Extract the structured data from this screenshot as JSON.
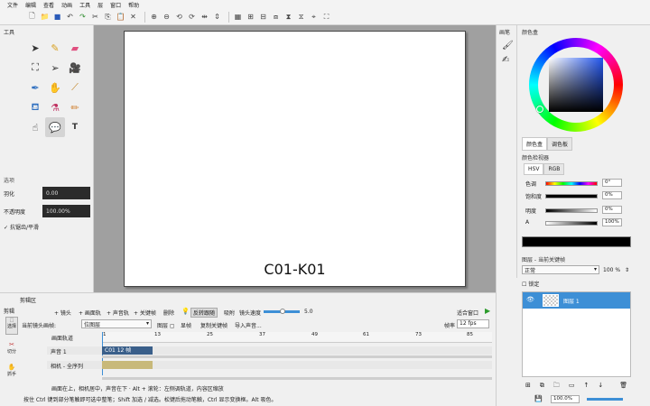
{
  "menu": [
    "文件",
    "编辑",
    "查看",
    "动画",
    "工具",
    "层",
    "窗口",
    "帮助"
  ],
  "panels": {
    "tools": "工具",
    "options": "选项",
    "brushes": "画笔",
    "color_box": "颜色盒",
    "color_box_tab": "颜色盒",
    "color_palette_tab": "调色板",
    "color_inspector": "颜色检视器",
    "layers": "图层 - 当前关键帧",
    "timeline": "剪辑区"
  },
  "options": {
    "feather_label": "羽化",
    "feather_value": "0.00",
    "opacity_label": "不透明度",
    "opacity_value": "100.00%",
    "antialias_label": "抗锯齿/平滑"
  },
  "canvas": {
    "caption": "C01-K01"
  },
  "color_inspector": {
    "tabs": [
      "HSV",
      "RGB"
    ],
    "rows": [
      {
        "label": "色调",
        "value": "0°"
      },
      {
        "label": "饱和度",
        "value": "0%"
      },
      {
        "label": "明度",
        "value": "0%"
      },
      {
        "label": "A",
        "value": "100%"
      }
    ]
  },
  "layers": {
    "blend_mode": "正常",
    "opacity": "100 %",
    "lock_label": "锁定",
    "layer_name": "图层 1",
    "zoom": "100.0%"
  },
  "timeline": {
    "top_label": "剪辑",
    "buttons": [
      "+ 镜头",
      "+ 画面轨",
      "+ 声音轨",
      "+ 关键帧",
      "删除"
    ],
    "onion": "反转跟随",
    "loop": "吸附",
    "speed_label": "镜头速度",
    "speed_value": "5.0",
    "fit_label": "适合窗口",
    "current_label": "当前镜头画帧:",
    "current_layer": "位图层",
    "layer_opts": [
      "图层 ▢",
      "显帧",
      "复制关键帧",
      "导入声音..."
    ],
    "fps_label": "帧率",
    "fps_value": "12 fps",
    "header": "画面轨道",
    "ticks": [
      "1",
      "13",
      "25",
      "37",
      "49",
      "61",
      "73",
      "85"
    ],
    "tracks": [
      {
        "name": "声音 1",
        "clip": "C01   12 帧"
      },
      {
        "name": "相机 - 全序列",
        "clip": ""
      }
    ],
    "side_tools": [
      "选择",
      "切分",
      "抓手"
    ],
    "hint": "画面在上，相机居中，声音在下 · Alt + 滚轮：左侧调轨道，内容区缩放",
    "status": "按住 Ctrl 键到部分笔触即可选中整笔；Shift 加选 / 减选。松键后拖动笔触，Ctrl 显示变换框。Alt 吸色。"
  },
  "colors": {
    "accent": "#3d8fd6",
    "clip_blue": "#3a5f8a",
    "clip_tan": "#c8b97a"
  }
}
